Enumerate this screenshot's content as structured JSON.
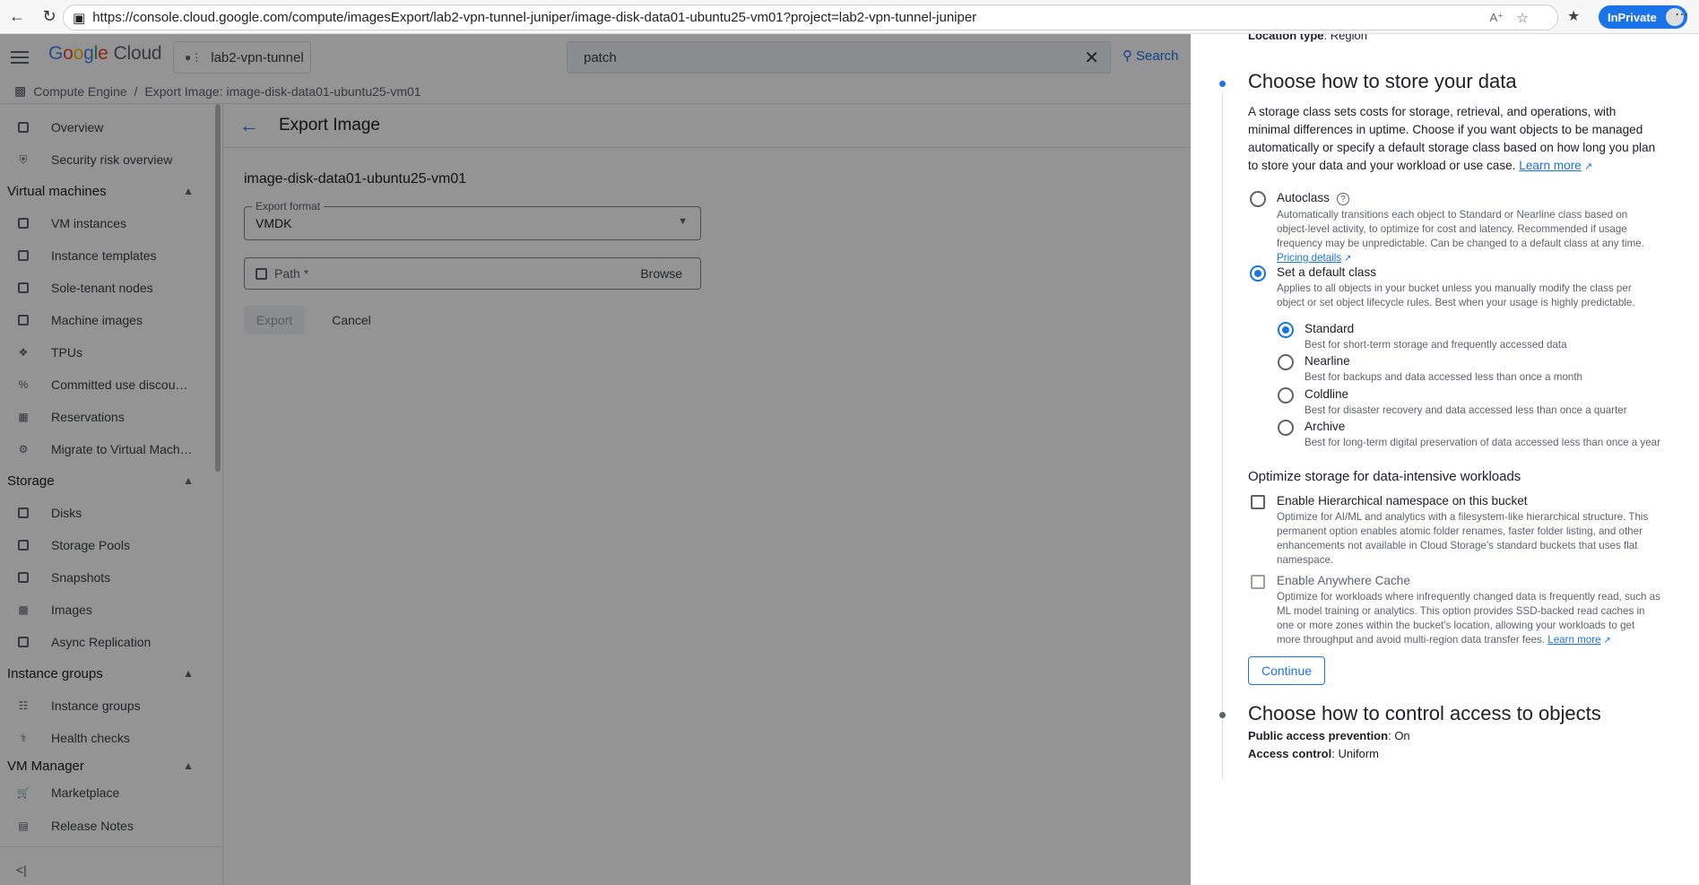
{
  "browser": {
    "url": "https://console.cloud.google.com/compute/imagesExport/lab2-vpn-tunnel-juniper/image-disk-data01-ubuntu25-vm01?project=lab2-vpn-tunnel-juniper",
    "inprivate_label": "InPrivate"
  },
  "header": {
    "logo_google": [
      "G",
      "o",
      "o",
      "g",
      "l",
      "e"
    ],
    "logo_cloud": "Cloud",
    "project": "lab2-vpn-tunnel",
    "search_value": "patch",
    "search_button": "Search"
  },
  "breadcrumb": {
    "root": "Compute Engine",
    "sep": "/",
    "current": "Export Image: image-disk-data01-ubuntu25-vm01"
  },
  "sidebar": {
    "top_items": [
      {
        "label": "Overview",
        "icon": "dashboard-icon"
      },
      {
        "label": "Security risk overview",
        "icon": "shield-icon"
      }
    ],
    "sections": [
      {
        "title": "Virtual machines",
        "items": [
          "VM instances",
          "Instance templates",
          "Sole-tenant nodes",
          "Machine images",
          "TPUs",
          "Committed use discou…",
          "Reservations",
          "Migrate to Virtual Mach…"
        ]
      },
      {
        "title": "Storage",
        "items": [
          "Disks",
          "Storage Pools",
          "Snapshots",
          "Images",
          "Async Replication"
        ]
      },
      {
        "title": "Instance groups",
        "items": [
          "Instance groups",
          "Health checks"
        ]
      },
      {
        "title": "VM Manager",
        "items": []
      }
    ],
    "bottom_items": [
      "Marketplace",
      "Release Notes"
    ],
    "collapse_glyph": "<|"
  },
  "main": {
    "title": "Export Image",
    "image_name": "image-disk-data01-ubuntu25-vm01",
    "export_format_label": "Export format",
    "export_format_value": "VMDK",
    "path_placeholder": "Path *",
    "browse_label": "Browse",
    "export_button": "Export",
    "cancel_button": "Cancel"
  },
  "panel": {
    "location_type_key": "Location type",
    "location_type_value": "Region",
    "store_heading": "Choose how to store your data",
    "store_desc_lines": [
      "A storage class sets costs for storage, retrieval, and operations, with",
      "minimal differences in uptime. Choose if you want objects to be managed",
      "automatically or specify a default storage class based on how long you plan",
      "to store your data and your workload or use case."
    ],
    "learn_more": "Learn more",
    "autoclass_label": "Autoclass",
    "autoclass_desc": [
      "Automatically transitions each object to Standard or Nearline class based on",
      "object-level activity, to optimize for cost and latency. Recommended if usage",
      "frequency may be unpredictable. Can be changed to a default class at any time."
    ],
    "pricing_details": "Pricing details",
    "default_class_label": "Set a default class",
    "default_class_desc": [
      "Applies to all objects in your bucket unless you manually modify the class per",
      "object or set object lifecycle rules. Best when your usage is highly predictable."
    ],
    "classes": [
      {
        "label": "Standard",
        "desc": "Best for short-term storage and frequently accessed data",
        "selected": true
      },
      {
        "label": "Nearline",
        "desc": "Best for backups and data accessed less than once a month",
        "selected": false
      },
      {
        "label": "Coldline",
        "desc": "Best for disaster recovery and data accessed less than once a quarter",
        "selected": false
      },
      {
        "label": "Archive",
        "desc": "Best for long-term digital preservation of data accessed less than once a year",
        "selected": false
      }
    ],
    "optimize_heading": "Optimize storage for data-intensive workloads",
    "hns_label": "Enable Hierarchical namespace on this bucket",
    "hns_desc": [
      "Optimize for AI/ML and analytics with a filesystem-like hierarchical structure. This",
      "permanent option enables atomic folder renames, faster folder listing, and other",
      "enhancements not available in Cloud Storage's standard buckets that uses flat",
      "namespace."
    ],
    "cache_label": "Enable Anywhere Cache",
    "cache_desc": [
      "Optimize for workloads where infrequently changed data is frequently read, such as",
      "ML model training or analytics. This option provides SSD-backed read caches in",
      "one or more zones within the bucket's location, allowing your workloads to get",
      "more throughput and avoid multi-region data transfer fees."
    ],
    "cache_learn_more": "Learn more",
    "continue_button": "Continue",
    "access_heading": "Choose how to control access to objects",
    "public_access_key": "Public access prevention",
    "public_access_value": "On",
    "access_control_key": "Access control",
    "access_control_value": "Uniform"
  },
  "colors": {
    "accent": "#1a73e8",
    "overlay": "rgba(0,0,0,0.42)"
  }
}
